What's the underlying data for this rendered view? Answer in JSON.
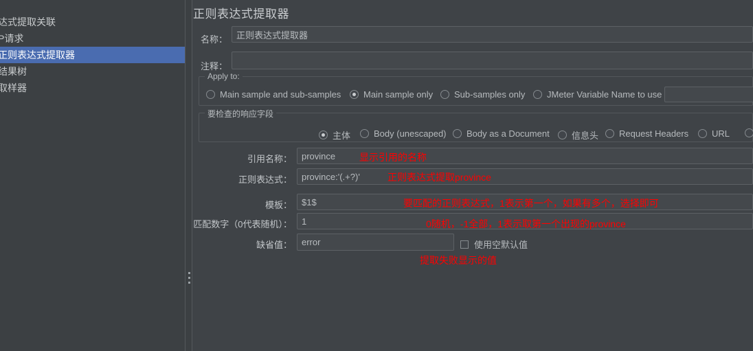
{
  "sidebar": {
    "items": [
      {
        "label": "达式提取关联",
        "selected": false
      },
      {
        "label": "P请求",
        "selected": false
      },
      {
        "label": "正则表达式提取器",
        "selected": true
      },
      {
        "label": "结果树",
        "selected": false
      },
      {
        "label": "取样器",
        "selected": false
      }
    ]
  },
  "panel": {
    "title": "正则表达式提取器",
    "name_label": "名称：",
    "name_value": "正则表达式提取器",
    "comment_label": "注释：",
    "comment_value": ""
  },
  "apply_to": {
    "legend": "Apply to:",
    "options": [
      {
        "label": "Main sample and sub-samples",
        "selected": false
      },
      {
        "label": "Main sample only",
        "selected": true
      },
      {
        "label": "Sub-samples only",
        "selected": false
      },
      {
        "label": "JMeter Variable Name to use",
        "selected": false
      }
    ],
    "variable_value": ""
  },
  "field_to_check": {
    "legend": "要检查的响应字段",
    "options": [
      {
        "label": "主体",
        "selected": true
      },
      {
        "label": "Body (unescaped)",
        "selected": false
      },
      {
        "label": "Body as a Document",
        "selected": false
      },
      {
        "label": "信息头",
        "selected": false
      },
      {
        "label": "Request Headers",
        "selected": false
      },
      {
        "label": "URL",
        "selected": false
      },
      {
        "label": "",
        "selected": false
      }
    ]
  },
  "fields": {
    "reference_name_label": "引用名称：",
    "reference_name_value": "province",
    "regex_label": "正则表达式：",
    "regex_value": "province:'(.+?)'",
    "template_label": "模板：",
    "template_value": "$1$",
    "match_no_label": "匹配数字（0代表随机）：",
    "match_no_value": "1",
    "default_value_label": "缺省值：",
    "default_value_value": "error",
    "use_empty_default_label": "使用空默认值",
    "use_empty_default_checked": false
  },
  "annotations": {
    "ref_name_note": "显示引用的名称",
    "regex_note": "正则表达式提取province",
    "template_note": "要匹配的正则表达式，1表示第一个，如果有多个，选择即可",
    "match_no_note": "0随机，-1全部，1表示取第一个出现的province",
    "default_note": "提取失败显示的值"
  },
  "colors": {
    "annotation": "#ff0000",
    "selection": "#4a6cb0",
    "panel_bg": "#3f4347",
    "sidebar_bg": "#3c4043"
  }
}
